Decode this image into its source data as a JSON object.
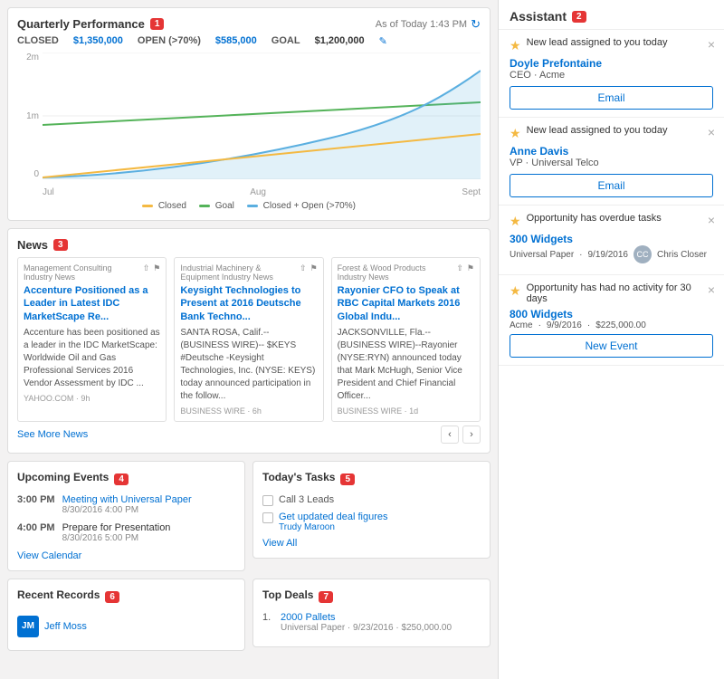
{
  "header": {
    "quarterly_title": "Quarterly Performance",
    "badge1": "1",
    "as_of": "As of Today 1:43 PM",
    "closed_label": "CLOSED",
    "closed_value": "$1,350,000",
    "open_label": "OPEN (>70%)",
    "open_value": "$585,000",
    "goal_label": "GOAL",
    "goal_value": "$1,200,000"
  },
  "chart": {
    "y_labels": [
      "2m",
      "1m",
      "0"
    ],
    "x_labels": [
      "Jul",
      "Aug",
      "Sept"
    ],
    "legend": [
      {
        "label": "Closed",
        "color": "#f4b942"
      },
      {
        "label": "Goal",
        "color": "#54b359"
      },
      {
        "label": "Closed + Open (>70%)",
        "color": "#5bafe0"
      }
    ]
  },
  "news": {
    "title": "News",
    "badge": "3",
    "see_more": "See More News",
    "items": [
      {
        "category": "Management Consulting Industry News",
        "headline": "Accenture Positioned as a Leader in Latest IDC MarketScape Re...",
        "body": "Accenture has been positioned as a leader in the IDC MarketScape: Worldwide Oil and Gas Professional Services 2016 Vendor Assessment by IDC ...",
        "source": "YAHOO.COM · 9h"
      },
      {
        "category": "Industrial Machinery & Equipment Industry News",
        "headline": "Keysight Technologies to Present at 2016 Deutsche Bank Techno...",
        "body": "SANTA ROSA, Calif.--(BUSINESS WIRE)-- $KEYS #Deutsche -Keysight Technologies, Inc. (NYSE: KEYS) today announced participation in the follow...",
        "source": "BUSINESS WIRE · 6h"
      },
      {
        "category": "Forest & Wood Products Industry News",
        "headline": "Rayonier CFO to Speak at RBC Capital Markets 2016 Global Indu...",
        "body": "JACKSONVILLE, Fla.--(BUSINESS WIRE)--Rayonier (NYSE:RYN) announced today that Mark McHugh, Senior Vice President and Chief Financial Officer...",
        "source": "BUSINESS WIRE · 1d"
      }
    ]
  },
  "upcoming_events": {
    "title": "Upcoming Events",
    "badge": "4",
    "events": [
      {
        "time": "3:00 PM",
        "name": "Meeting with Universal Paper",
        "date": "8/30/2016 4:00 PM"
      },
      {
        "time": "4:00 PM",
        "name": "Prepare for Presentation",
        "date": "8/30/2016 5:00 PM"
      }
    ],
    "view_link": "View Calendar"
  },
  "tasks": {
    "title": "Today's Tasks",
    "badge": "5",
    "items": [
      {
        "text": "Call 3 Leads",
        "link": false,
        "assignee": ""
      },
      {
        "text": "Get updated deal figures",
        "link": true,
        "assignee": "Trudy Maroon"
      }
    ],
    "view_link": "View All"
  },
  "recent_records": {
    "title": "Recent Records",
    "badge": "6",
    "items": [
      {
        "name": "Jeff Moss",
        "color": "#0070d2",
        "initials": "JM"
      }
    ]
  },
  "top_deals": {
    "title": "Top Deals",
    "badge": "7",
    "items": [
      {
        "num": "1.",
        "name": "2000 Pallets",
        "company": "Universal Paper",
        "date": "9/23/2016",
        "amount": "$250,000.00"
      }
    ]
  },
  "assistant": {
    "title": "Assistant",
    "badge": "2",
    "cards": [
      {
        "type": "lead",
        "star_color": "#f4b942",
        "title": "New lead assigned to you today",
        "name": "Doyle Prefontaine",
        "role": "CEO · Acme",
        "btn_label": "Email"
      },
      {
        "type": "lead",
        "star_color": "#f4b942",
        "title": "New lead assigned to you today",
        "name": "Anne Davis",
        "role": "VP · Universal Telco",
        "btn_label": "Email"
      },
      {
        "type": "opportunity",
        "star_color": "#f4b942",
        "title": "Opportunity has overdue tasks",
        "opp_name": "300 Widgets",
        "company": "Universal Paper",
        "date": "9/19/2016",
        "assignee": "Chris Closer"
      },
      {
        "type": "activity",
        "star_color": "#f4b942",
        "title": "Opportunity has had no activity for 30 days",
        "opp_name": "800 Widgets",
        "company": "Acme",
        "date": "9/9/2016",
        "amount": "$225,000.00",
        "btn_label": "New Event"
      }
    ]
  }
}
